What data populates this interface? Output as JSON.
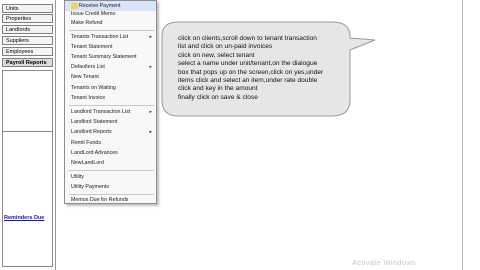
{
  "nav": {
    "items": [
      {
        "label": "Units"
      },
      {
        "label": "Properties"
      },
      {
        "label": "Landlords"
      },
      {
        "label": "Suppliers"
      },
      {
        "label": "Employees"
      },
      {
        "label": "Payroll Reports"
      }
    ],
    "reminders_label": "Reminders Due"
  },
  "menu": {
    "items": [
      {
        "label": "Receive Payment"
      },
      {
        "label": "Issue Credit Memo"
      },
      {
        "label": "Make Refund"
      },
      {
        "label": "Tenants Transaction List",
        "submenu": true
      },
      {
        "label": "Tenant Statement"
      },
      {
        "label": "Tenant Summary Statement"
      },
      {
        "label": "Defaulters List",
        "submenu": true
      },
      {
        "label": "New Tenant"
      },
      {
        "label": "Tenants on Waiting"
      },
      {
        "label": "Tenant Invoice"
      },
      {
        "label": "Landlord Transaction List",
        "submenu": true
      },
      {
        "label": "Landlord Statement"
      },
      {
        "label": "Landlord Reports",
        "submenu": true
      },
      {
        "label": "Remit Funds"
      },
      {
        "label": "LandLord Advances"
      },
      {
        "label": "NewLandLord"
      },
      {
        "label": "Utility"
      },
      {
        "label": "Utility Payments"
      },
      {
        "label": "Memos Due for Refunds"
      }
    ],
    "arrow_glyph": "▸"
  },
  "callout": {
    "lines": [
      "click on clients,scroll down to tenant transaction",
      "list and click on un-paid invoices",
      "click on new, select tenant",
      "select a name under unit/tenant,on the dialogue",
      "box that pops up on the screen,click on yes,under",
      "items click and select an item,under rate double",
      "click and key in the amount",
      "finally click on save & close"
    ]
  },
  "watermark": "Activate Windows"
}
